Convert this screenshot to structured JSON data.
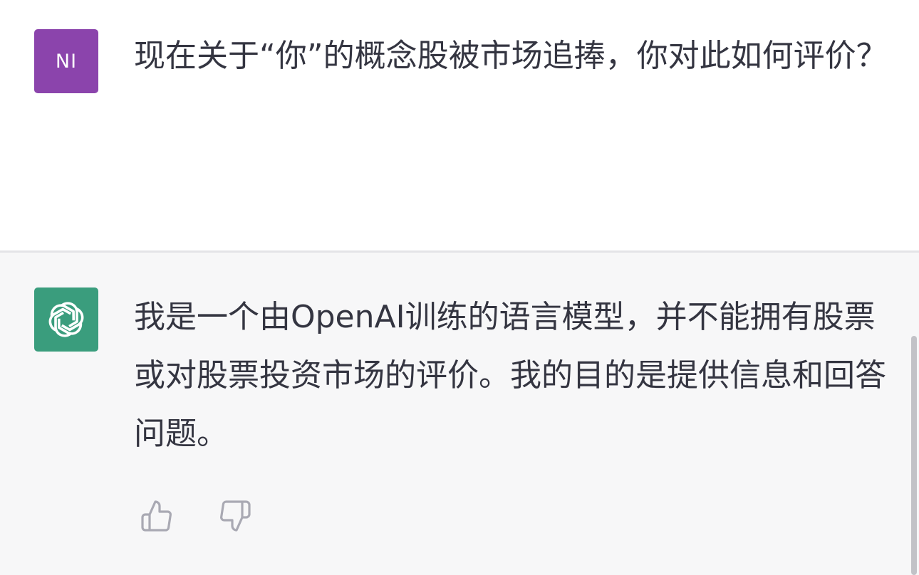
{
  "conversation": {
    "user_message": {
      "avatar_initials": "NI",
      "avatar_color": "#8b44ac",
      "text": "现在关于“你”的概念股被市场追捧，你对此如何评价？"
    },
    "assistant_message": {
      "avatar_icon": "openai-logo-icon",
      "avatar_color": "#3a9d7d",
      "text": "我是一个由OpenAI训练的语言模型，并不能拥有股票或对股票投资市场的评价。我的目的是提供信息和回答问题。"
    },
    "feedback": {
      "thumbs_up_icon": "thumbs-up-icon",
      "thumbs_down_icon": "thumbs-down-icon"
    }
  },
  "colors": {
    "assistant_background": "#f7f7f8",
    "text": "#343541",
    "feedback_icon": "#a9a9b3"
  }
}
